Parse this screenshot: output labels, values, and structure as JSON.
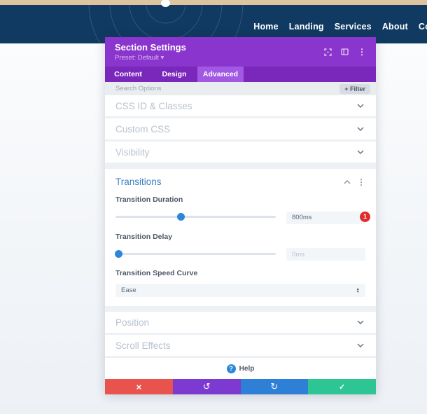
{
  "nav": {
    "items": [
      {
        "label": "Home"
      },
      {
        "label": "Landing"
      },
      {
        "label": "Services"
      },
      {
        "label": "About"
      },
      {
        "label": "Co"
      }
    ]
  },
  "modal": {
    "title": "Section Settings",
    "preset_label": "Preset: Default",
    "preset_caret": "▾",
    "tabs": [
      {
        "label": "Content"
      },
      {
        "label": "Design"
      },
      {
        "label": "Advanced"
      }
    ],
    "active_tab": "Advanced",
    "search": {
      "placeholder": "Search Options",
      "filter_label": "+ Filter"
    },
    "sections_top": [
      {
        "title": "CSS ID & Classes"
      },
      {
        "title": "Custom CSS"
      },
      {
        "title": "Visibility"
      }
    ],
    "transitions": {
      "title": "Transitions",
      "duration": {
        "label": "Transition Duration",
        "value": "800ms",
        "slider_percent": 41,
        "badge_count": "1"
      },
      "delay": {
        "label": "Transition Delay",
        "placeholder": "0ms",
        "slider_percent": 2
      },
      "speed_curve": {
        "label": "Transition Speed Curve",
        "selected": "Ease"
      }
    },
    "sections_bottom": [
      {
        "title": "Position"
      },
      {
        "title": "Scroll Effects"
      }
    ],
    "help_label": "Help",
    "actions": [
      {
        "name": "cancel",
        "glyph": "×"
      },
      {
        "name": "undo",
        "glyph": "↺"
      },
      {
        "name": "redo",
        "glyph": "↻"
      },
      {
        "name": "save",
        "glyph": "✓"
      }
    ]
  },
  "colors": {
    "navy_header": "#113a62",
    "tan_strip": "#dfc2a0",
    "purple_header": "#8a35cd",
    "purple_tabbar": "#7a28bb",
    "purple_tab_active": "#a158e2",
    "accent_blue": "#2b87da",
    "open_section_title_blue": "#3d7fc1",
    "badge_red": "#e02b2b",
    "btn_red": "#e8534e",
    "btn_purple": "#7d3ad0",
    "btn_blue": "#2e7fd6",
    "btn_green": "#2cc593"
  }
}
